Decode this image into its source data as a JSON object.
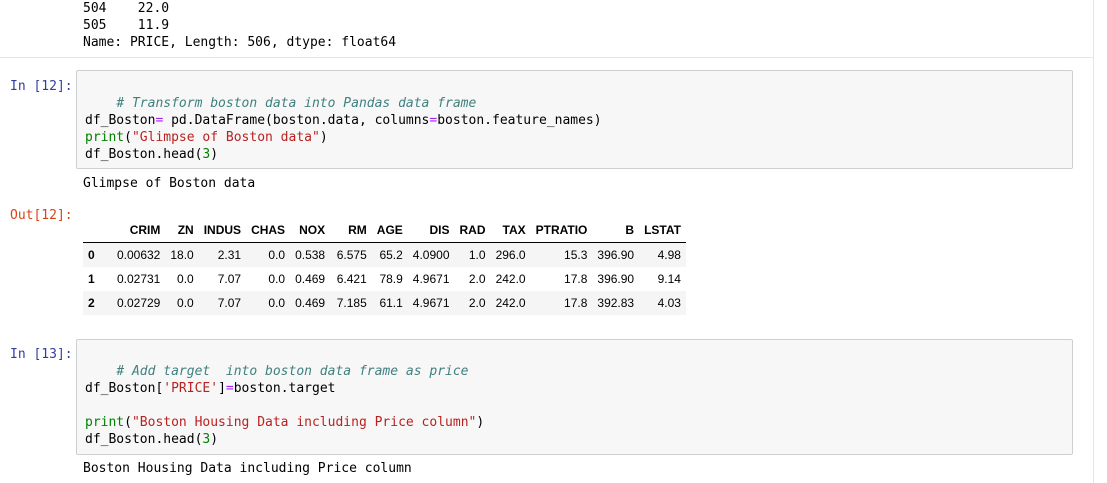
{
  "prev_output": {
    "line1": "504    22.0",
    "line2": "505    11.9",
    "line3": "Name: PRICE, Length: 506, dtype: float64"
  },
  "cell12": {
    "prompt": "In [12]:",
    "comment": "# Transform boston data into Pandas data frame",
    "line2_a": "df_Boston",
    "line2_op": "=",
    "line2_b": " pd.DataFrame(boston.data, columns",
    "line2_op2": "=",
    "line2_c": "boston.feature_names)",
    "line3_fn": "print",
    "line3_str": "\"Glimpse of Boston data\"",
    "line3_open": "(",
    "line3_close": ")",
    "line4_a": "df_Boston.head(",
    "line4_num": "3",
    "line4_close": ")",
    "stdout": "Glimpse of Boston data",
    "out_prompt": "Out[12]:"
  },
  "dataframe": {
    "columns": [
      "",
      "CRIM",
      "ZN",
      "INDUS",
      "CHAS",
      "NOX",
      "RM",
      "AGE",
      "DIS",
      "RAD",
      "TAX",
      "PTRATIO",
      "B",
      "LSTAT"
    ],
    "rows": [
      [
        "0",
        "0.00632",
        "18.0",
        "2.31",
        "0.0",
        "0.538",
        "6.575",
        "65.2",
        "4.0900",
        "1.0",
        "296.0",
        "15.3",
        "396.90",
        "4.98"
      ],
      [
        "1",
        "0.02731",
        "0.0",
        "7.07",
        "0.0",
        "0.469",
        "6.421",
        "78.9",
        "4.9671",
        "2.0",
        "242.0",
        "17.8",
        "396.90",
        "9.14"
      ],
      [
        "2",
        "0.02729",
        "0.0",
        "7.07",
        "0.0",
        "0.469",
        "7.185",
        "61.1",
        "4.9671",
        "2.0",
        "242.0",
        "17.8",
        "392.83",
        "4.03"
      ]
    ]
  },
  "cell13": {
    "prompt": "In [13]:",
    "comment": "# Add target  into boston data frame as price",
    "line2_a": "df_Boston[",
    "line2_str": "'PRICE'",
    "line2_b": "]",
    "line2_op": "=",
    "line2_c": "boston.target",
    "line3_fn": "print",
    "line3_open": "(",
    "line3_str": "\"Boston Housing Data including Price column\"",
    "line3_close": ")",
    "line4_a": "df_Boston.head(",
    "line4_num": "3",
    "line4_close": ")",
    "stdout": "Boston Housing Data including Price column"
  }
}
